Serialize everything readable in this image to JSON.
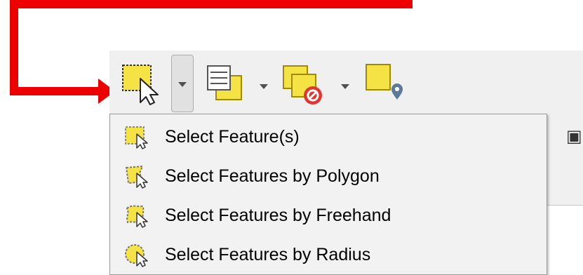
{
  "toolbar": {
    "tools": [
      {
        "icon": "select-feature-icon"
      },
      {
        "icon": "select-by-attribute-icon"
      },
      {
        "icon": "deselect-features-icon"
      },
      {
        "icon": "select-by-location-icon"
      }
    ]
  },
  "menu": {
    "items": [
      {
        "label": "Select Feature(s)",
        "icon": "select-rectangle-icon"
      },
      {
        "label": "Select Features by Polygon",
        "icon": "select-polygon-icon"
      },
      {
        "label": "Select Features by Freehand",
        "icon": "select-freehand-icon"
      },
      {
        "label": "Select Features by Radius",
        "icon": "select-radius-icon"
      }
    ]
  },
  "colors": {
    "annotation": "#ee0000",
    "feature_yellow": "#f5e245",
    "feature_outline": "#a08a00",
    "deselect_red": "#e1362f",
    "pin_blue": "#5b7a9a"
  }
}
